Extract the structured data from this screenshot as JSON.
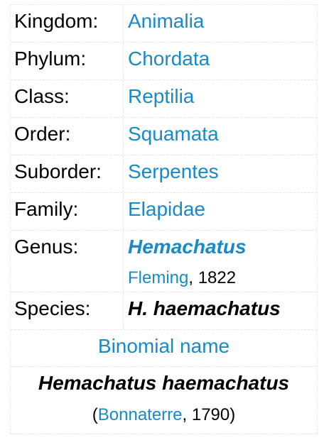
{
  "taxonomy": {
    "kingdom": {
      "label": "Kingdom:",
      "value": "Animalia"
    },
    "phylum": {
      "label": "Phylum:",
      "value": "Chordata"
    },
    "class": {
      "label": "Class:",
      "value": "Reptilia"
    },
    "order": {
      "label": "Order:",
      "value": "Squamata"
    },
    "suborder": {
      "label": "Suborder:",
      "value": "Serpentes"
    },
    "family": {
      "label": "Family:",
      "value": "Elapidae"
    },
    "genus": {
      "label": "Genus:",
      "value": "Hemachatus",
      "authority_name": "Fleming",
      "authority_year": ", 1822"
    },
    "species": {
      "label": "Species:",
      "value": "H. haemachatus"
    }
  },
  "binomial": {
    "header": "Binomial name",
    "name": "Hemachatus haemachatus",
    "open_paren": "(",
    "authority_name": "Bonnaterre",
    "authority_year": ", 1790)"
  },
  "colors": {
    "link": "#1a89c5",
    "border": "#e6e6e6",
    "text": "#000000"
  }
}
